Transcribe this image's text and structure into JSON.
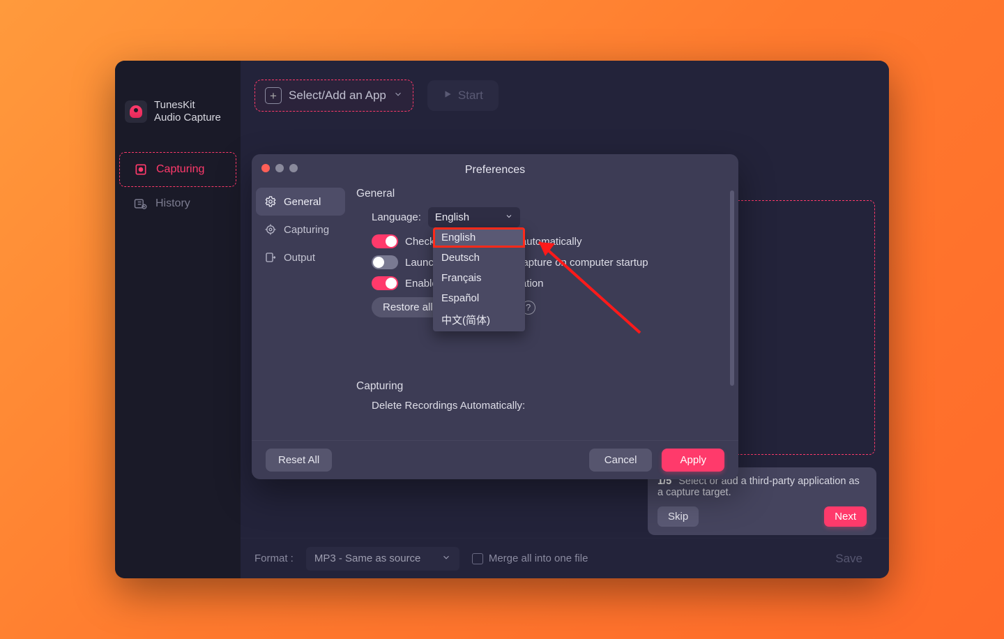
{
  "brand": {
    "line1": "TunesKit",
    "line2": "Audio Capture"
  },
  "sidebar": {
    "items": [
      {
        "label": "Capturing"
      },
      {
        "label": "History"
      }
    ]
  },
  "toolbar": {
    "selectAdd": "Select/Add an App",
    "start": "Start"
  },
  "bottomBar": {
    "formatLabel": "Format :",
    "formatValue": "MP3 - Same as source",
    "merge": "Merge all into one file",
    "save": "Save"
  },
  "tutorial": {
    "step": "1/5",
    "text": "Select or add a third-party application as a capture target.",
    "skip": "Skip",
    "next": "Next"
  },
  "prefs": {
    "title": "Preferences",
    "nav": [
      {
        "label": "General"
      },
      {
        "label": "Capturing"
      },
      {
        "label": "Output"
      }
    ],
    "sectionGeneral": "General",
    "languageLabel": "Language:",
    "languageValue": "English",
    "languageOptions": [
      "English",
      "Deutsch",
      "Français",
      "Español",
      "中文(简体)"
    ],
    "check": "Check for newer version automatically",
    "launch": "Launch TunesKit Audio Capture on computer startup",
    "enable": "Enable hardware acceleration",
    "restore": "Restore all hidden dialogs",
    "sectionCapturing": "Capturing",
    "deleteLabel": "Delete Recordings Automatically:",
    "reset": "Reset All",
    "cancel": "Cancel",
    "apply": "Apply"
  }
}
